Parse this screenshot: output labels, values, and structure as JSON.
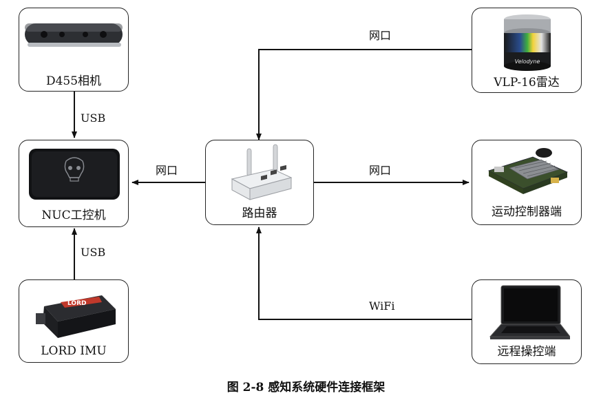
{
  "nodes": {
    "d455": {
      "label": "D455相机",
      "icon": "depth-camera-icon"
    },
    "nuc": {
      "label": "NUC工控机",
      "icon": "nuc-computer-icon"
    },
    "imu": {
      "label": "LORD IMU",
      "icon": "imu-sensor-icon",
      "icon_text": "LORD"
    },
    "router": {
      "label": "路由器",
      "icon": "router-icon"
    },
    "lidar": {
      "label": "VLP-16雷达",
      "icon": "lidar-icon",
      "icon_text": "Velodyne"
    },
    "motion": {
      "label": "运动控制器端",
      "icon": "circuit-board-icon"
    },
    "remote": {
      "label": "远程操控端",
      "icon": "laptop-icon"
    }
  },
  "edges": {
    "d455_nuc": "USB",
    "imu_nuc": "USB",
    "router_nuc": "网口",
    "lidar_router": "网口",
    "router_motion": "网口",
    "remote_router": "WiFi"
  },
  "caption": "图 2-8  感知系统硬件连接框架"
}
